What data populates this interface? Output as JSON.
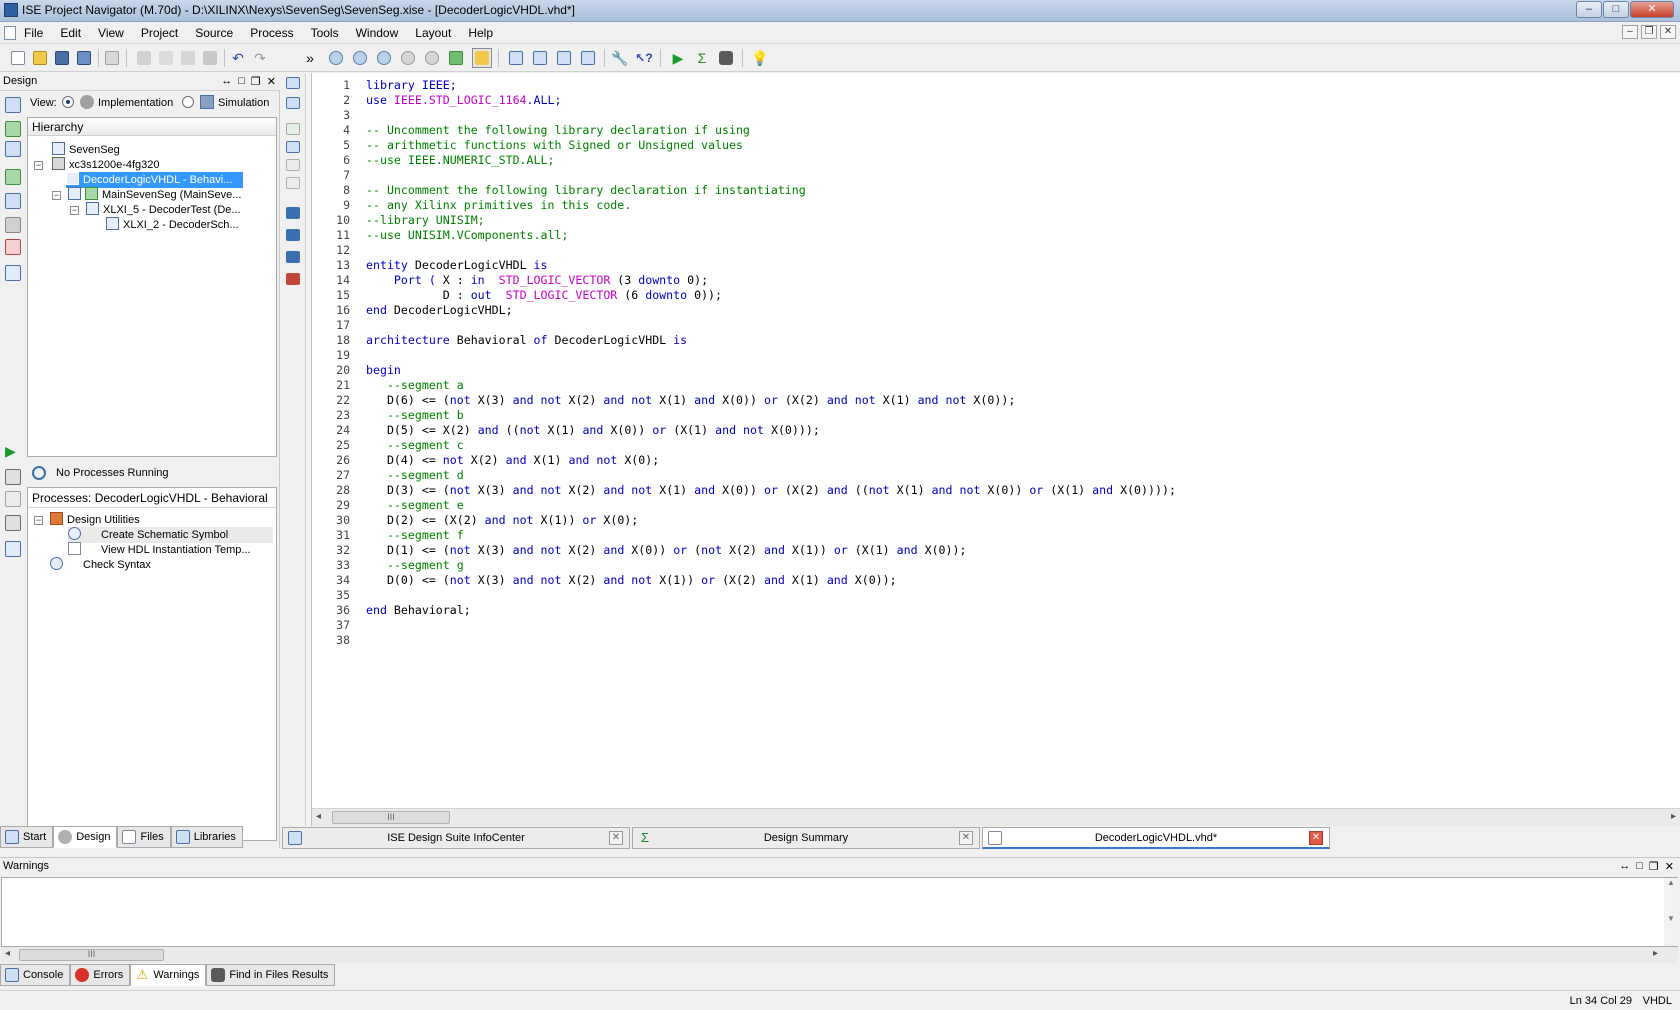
{
  "window": {
    "title": "ISE Project Navigator (M.70d) - D:\\XILINX\\Nexys\\SevenSeg\\SevenSeg.xise - [DecoderLogicVHDL.vhd*]",
    "minimize": "–",
    "restore": "□",
    "close": "✕"
  },
  "menu": [
    "File",
    "Edit",
    "View",
    "Project",
    "Source",
    "Process",
    "Tools",
    "Window",
    "Layout",
    "Help"
  ],
  "toolbar": {
    "overflow": "»"
  },
  "design_panel": {
    "title": "Design",
    "view_label": "View:",
    "implementation": "Implementation",
    "simulation": "Simulation",
    "hierarchy_header": "Hierarchy",
    "tree": [
      "SevenSeg",
      "xc3s1200e-4fg320",
      "DecoderLogicVHDL - Behavi...",
      "MainSevenSeg (MainSeve...",
      "XLXI_5 - DecoderTest (De...",
      "XLXI_2 - DecoderSch..."
    ],
    "process_status": "No Processes Running",
    "processes_header": "Processes: DecoderLogicVHDL - Behavioral",
    "processes": [
      "Design Utilities",
      "Create Schematic Symbol",
      "View HDL Instantiation Temp...",
      "Check Syntax"
    ]
  },
  "left_tabs": [
    "Start",
    "Design",
    "Files",
    "Libraries"
  ],
  "editor": {
    "lines": [
      [
        {
          "t": "library IEEE;",
          "c": "kw"
        }
      ],
      [
        {
          "t": "use ",
          "c": "kw"
        },
        {
          "t": "IEEE.STD_LOGIC_1164",
          "c": "ty"
        },
        {
          "t": ".ALL;",
          "c": "kw"
        }
      ],
      [],
      [
        {
          "t": "-- Uncomment the following library declaration if using",
          "c": "cm"
        }
      ],
      [
        {
          "t": "-- arithmetic functions with Signed or Unsigned values",
          "c": "cm"
        }
      ],
      [
        {
          "t": "--use IEEE.NUMERIC_STD.ALL;",
          "c": "cm"
        }
      ],
      [],
      [
        {
          "t": "-- Uncomment the following library declaration if instantiating",
          "c": "cm"
        }
      ],
      [
        {
          "t": "-- any Xilinx primitives in this code.",
          "c": "cm"
        }
      ],
      [
        {
          "t": "--library UNISIM;",
          "c": "cm"
        }
      ],
      [
        {
          "t": "--use UNISIM.VComponents.all;",
          "c": "cm"
        }
      ],
      [],
      [
        {
          "t": "entity ",
          "c": "kw"
        },
        {
          "t": "DecoderLogicVHDL ",
          "c": ""
        },
        {
          "t": "is",
          "c": "kw"
        }
      ],
      [
        {
          "t": "    Port ( ",
          "c": "kw"
        },
        {
          "t": "X : ",
          "c": ""
        },
        {
          "t": "in  ",
          "c": "kw"
        },
        {
          "t": "STD_LOGIC_VECTOR",
          "c": "ty"
        },
        {
          "t": " (3 ",
          "c": ""
        },
        {
          "t": "downto",
          "c": "kw"
        },
        {
          "t": " 0);",
          "c": ""
        }
      ],
      [
        {
          "t": "           D : ",
          "c": ""
        },
        {
          "t": "out  ",
          "c": "kw"
        },
        {
          "t": "STD_LOGIC_VECTOR",
          "c": "ty"
        },
        {
          "t": " (6 ",
          "c": ""
        },
        {
          "t": "downto",
          "c": "kw"
        },
        {
          "t": " 0));",
          "c": ""
        }
      ],
      [
        {
          "t": "end ",
          "c": "kw"
        },
        {
          "t": "DecoderLogicVHDL;",
          "c": ""
        }
      ],
      [],
      [
        {
          "t": "architecture ",
          "c": "kw"
        },
        {
          "t": "Behavioral ",
          "c": ""
        },
        {
          "t": "of ",
          "c": "kw"
        },
        {
          "t": "DecoderLogicVHDL ",
          "c": ""
        },
        {
          "t": "is",
          "c": "kw"
        }
      ],
      [],
      [
        {
          "t": "begin",
          "c": "kw"
        }
      ],
      [
        {
          "t": "   --segment a",
          "c": "cm"
        }
      ],
      [
        {
          "t": "   D(6) <= (",
          "c": ""
        },
        {
          "t": "not",
          "c": "kw"
        },
        {
          "t": " X(3) ",
          "c": ""
        },
        {
          "t": "and not",
          "c": "kw"
        },
        {
          "t": " X(2) ",
          "c": ""
        },
        {
          "t": "and not",
          "c": "kw"
        },
        {
          "t": " X(1) ",
          "c": ""
        },
        {
          "t": "and",
          "c": "kw"
        },
        {
          "t": " X(0)) ",
          "c": ""
        },
        {
          "t": "or",
          "c": "kw"
        },
        {
          "t": " (X(2) ",
          "c": ""
        },
        {
          "t": "and not",
          "c": "kw"
        },
        {
          "t": " X(1) ",
          "c": ""
        },
        {
          "t": "and not",
          "c": "kw"
        },
        {
          "t": " X(0));",
          "c": ""
        }
      ],
      [
        {
          "t": "   --segment b",
          "c": "cm"
        }
      ],
      [
        {
          "t": "   D(5) <= X(2) ",
          "c": ""
        },
        {
          "t": "and",
          "c": "kw"
        },
        {
          "t": " ((",
          "c": ""
        },
        {
          "t": "not",
          "c": "kw"
        },
        {
          "t": " X(1) ",
          "c": ""
        },
        {
          "t": "and",
          "c": "kw"
        },
        {
          "t": " X(0)) ",
          "c": ""
        },
        {
          "t": "or",
          "c": "kw"
        },
        {
          "t": " (X(1) ",
          "c": ""
        },
        {
          "t": "and not",
          "c": "kw"
        },
        {
          "t": " X(0)));",
          "c": ""
        }
      ],
      [
        {
          "t": "   --segment c",
          "c": "cm"
        }
      ],
      [
        {
          "t": "   D(4) <= ",
          "c": ""
        },
        {
          "t": "not",
          "c": "kw"
        },
        {
          "t": " X(2) ",
          "c": ""
        },
        {
          "t": "and",
          "c": "kw"
        },
        {
          "t": " X(1) ",
          "c": ""
        },
        {
          "t": "and not",
          "c": "kw"
        },
        {
          "t": " X(0);",
          "c": ""
        }
      ],
      [
        {
          "t": "   --segment d",
          "c": "cm"
        }
      ],
      [
        {
          "t": "   D(3) <= (",
          "c": ""
        },
        {
          "t": "not",
          "c": "kw"
        },
        {
          "t": " X(3) ",
          "c": ""
        },
        {
          "t": "and not",
          "c": "kw"
        },
        {
          "t": " X(2) ",
          "c": ""
        },
        {
          "t": "and not",
          "c": "kw"
        },
        {
          "t": " X(1) ",
          "c": ""
        },
        {
          "t": "and",
          "c": "kw"
        },
        {
          "t": " X(0)) ",
          "c": ""
        },
        {
          "t": "or",
          "c": "kw"
        },
        {
          "t": " (X(2) ",
          "c": ""
        },
        {
          "t": "and",
          "c": "kw"
        },
        {
          "t": " ((",
          "c": ""
        },
        {
          "t": "not",
          "c": "kw"
        },
        {
          "t": " X(1) ",
          "c": ""
        },
        {
          "t": "and not",
          "c": "kw"
        },
        {
          "t": " X(0)) ",
          "c": ""
        },
        {
          "t": "or",
          "c": "kw"
        },
        {
          "t": " (X(1) ",
          "c": ""
        },
        {
          "t": "and",
          "c": "kw"
        },
        {
          "t": " X(0))));",
          "c": ""
        }
      ],
      [
        {
          "t": "   --segment e",
          "c": "cm"
        }
      ],
      [
        {
          "t": "   D(2) <= (X(2) ",
          "c": ""
        },
        {
          "t": "and not",
          "c": "kw"
        },
        {
          "t": " X(1)) ",
          "c": ""
        },
        {
          "t": "or",
          "c": "kw"
        },
        {
          "t": " X(0);",
          "c": ""
        }
      ],
      [
        {
          "t": "   --segment f",
          "c": "cm"
        }
      ],
      [
        {
          "t": "   D(1) <= (",
          "c": ""
        },
        {
          "t": "not",
          "c": "kw"
        },
        {
          "t": " X(3) ",
          "c": ""
        },
        {
          "t": "and not",
          "c": "kw"
        },
        {
          "t": " X(2) ",
          "c": ""
        },
        {
          "t": "and",
          "c": "kw"
        },
        {
          "t": " X(0)) ",
          "c": ""
        },
        {
          "t": "or",
          "c": "kw"
        },
        {
          "t": " (",
          "c": ""
        },
        {
          "t": "not",
          "c": "kw"
        },
        {
          "t": " X(2) ",
          "c": ""
        },
        {
          "t": "and",
          "c": "kw"
        },
        {
          "t": " X(1)) ",
          "c": ""
        },
        {
          "t": "or",
          "c": "kw"
        },
        {
          "t": " (X(1) ",
          "c": ""
        },
        {
          "t": "and",
          "c": "kw"
        },
        {
          "t": " X(0));",
          "c": ""
        }
      ],
      [
        {
          "t": "   --segment g",
          "c": "cm"
        }
      ],
      [
        {
          "t": "   D(0) <= (",
          "c": ""
        },
        {
          "t": "not",
          "c": "kw"
        },
        {
          "t": " X(3) ",
          "c": ""
        },
        {
          "t": "and not",
          "c": "kw"
        },
        {
          "t": " X(2) ",
          "c": ""
        },
        {
          "t": "and not",
          "c": "kw"
        },
        {
          "t": " X(1)) ",
          "c": ""
        },
        {
          "t": "or",
          "c": "kw"
        },
        {
          "t": " (X(2) ",
          "c": ""
        },
        {
          "t": "and",
          "c": "kw"
        },
        {
          "t": " X(1) ",
          "c": ""
        },
        {
          "t": "and",
          "c": "kw"
        },
        {
          "t": " X(0));",
          "c": ""
        }
      ],
      [],
      [
        {
          "t": "end ",
          "c": "kw"
        },
        {
          "t": "Behavioral;",
          "c": ""
        }
      ],
      [],
      []
    ],
    "scroll_thumb": "III"
  },
  "doc_tabs": [
    "ISE Design Suite InfoCenter",
    "Design Summary",
    "DecoderLogicVHDL.vhd*"
  ],
  "warnings_panel": {
    "title": "Warnings",
    "scroll_thumb": "III"
  },
  "bottom_tabs": [
    "Console",
    "Errors",
    "Warnings",
    "Find in Files Results"
  ],
  "status": {
    "position": "Ln 34 Col 29",
    "language": "VHDL"
  },
  "colors": {
    "keyword": "#0000c8",
    "comment": "#008000",
    "type": "#c800c8",
    "selection": "#3399ff"
  }
}
